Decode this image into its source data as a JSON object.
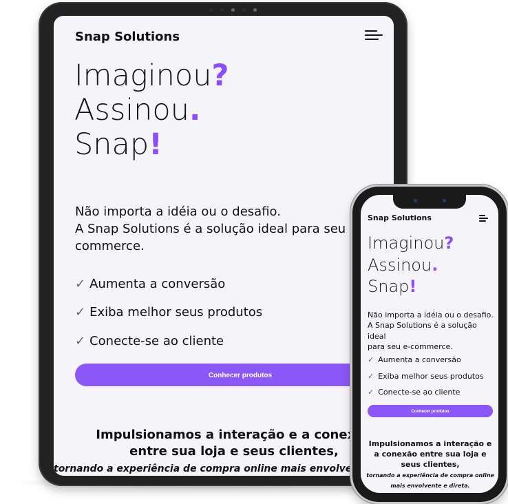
{
  "brand": "Snap Solutions",
  "hero": {
    "line1": "Imaginou",
    "mark1": "?",
    "line2": "Assinou",
    "mark2": ".",
    "line3": "Snap",
    "mark3": "!"
  },
  "lead": {
    "line1": "Não importa a idéia ou o desafio.",
    "tablet_line2": "A Snap Solutions é a solução ideal para seu e-",
    "tablet_line3": "commerce.",
    "phone_line2": "A Snap Solutions é a solução ideal",
    "phone_line3": "para seu e-commerce."
  },
  "features": [
    "Aumenta a conversão",
    "Exiba melhor seus produtos",
    "Conecte-se ao cliente"
  ],
  "check_icon": "✓",
  "cta_label": "Conhecer produtos",
  "section": {
    "title": "Impulsionamos a interação e a conexão entre sua loja e seus clientes,",
    "subtitle": "tornando a experiência de compra online mais envolvente e direta."
  },
  "colors": {
    "accent": "#8b4dfa",
    "button": "#8b57f6",
    "screen_bg": "#f5f4f8"
  }
}
